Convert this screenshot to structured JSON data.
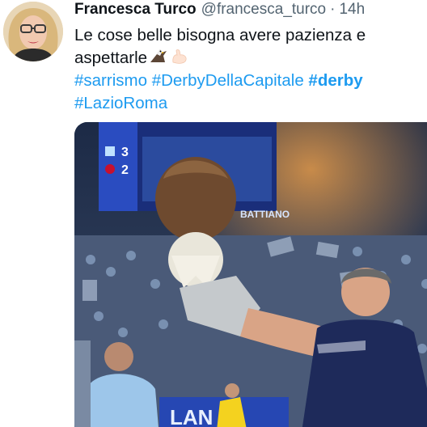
{
  "author": {
    "display_name": "Francesca Turco",
    "handle": "@francesca_turco",
    "separator": "·",
    "timestamp": "14h",
    "avatar_icon": "profile-photo-woman-glasses"
  },
  "tweet": {
    "text_line1": "Le cose belle bisogna avere pazienza e",
    "text_line2": "aspettarle",
    "emojis": [
      "eagle-emoji",
      "flexed-biceps-emoji"
    ],
    "hashtags": [
      {
        "text": "#sarrismo",
        "bold": false
      },
      {
        "text": "#DerbyDellaCapitale",
        "bold": false
      },
      {
        "text": "#derby",
        "bold": true
      },
      {
        "text": "#LazioRoma",
        "bold": false
      }
    ],
    "link_color": "#1d9bf0"
  },
  "media": {
    "scoreboard": {
      "home_score": "3",
      "away_score": "2",
      "banner_text": "BATTIANO"
    },
    "banner_text": "LAN"
  }
}
